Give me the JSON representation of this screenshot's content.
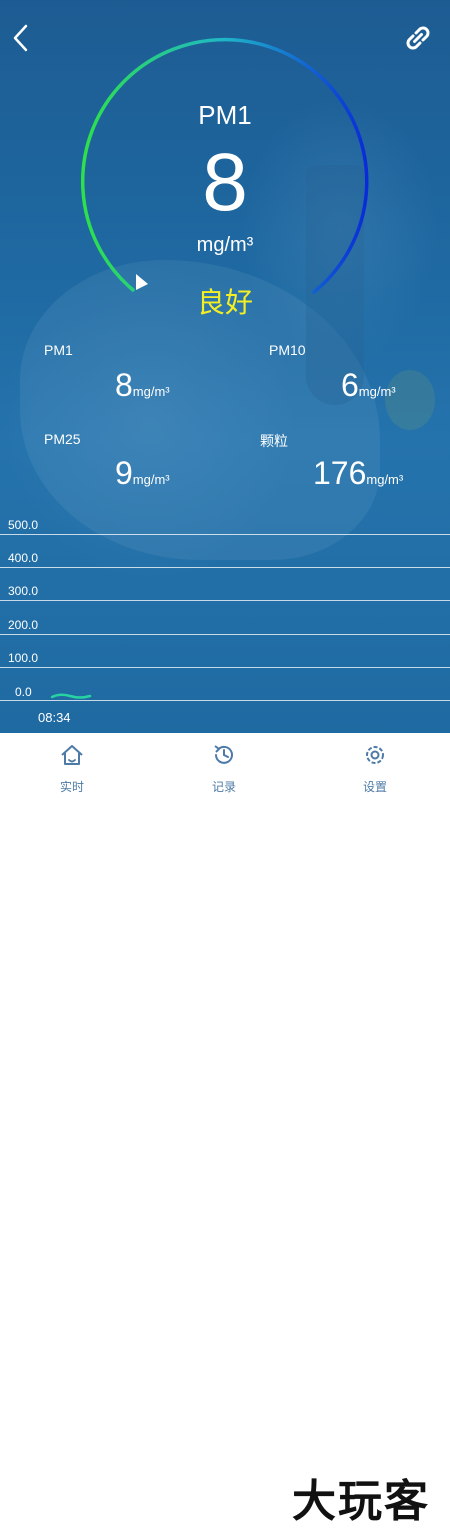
{
  "header": {
    "back_icon": "chevron-left-icon",
    "link_icon": "link-icon"
  },
  "gauge": {
    "title": "PM1",
    "value": "8",
    "unit": "mg/m³",
    "status": "良好",
    "colors": {
      "start": "#2ee04a",
      "end": "#0a2bd8"
    }
  },
  "metrics": [
    {
      "name": "PM1",
      "value": "8",
      "unit": "mg/m³"
    },
    {
      "name": "PM10",
      "value": "6",
      "unit": "mg/m³"
    },
    {
      "name": "PM25",
      "value": "9",
      "unit": "mg/m³"
    },
    {
      "name": "颗粒",
      "value": "176",
      "unit": "mg/m³"
    }
  ],
  "chart": {
    "y_ticks": [
      "500.0",
      "400.0",
      "300.0",
      "200.0",
      "100.0",
      "0.0"
    ],
    "time": "08:34",
    "line_color": "#27d3a0"
  },
  "tabbar": {
    "items": [
      {
        "label": "实时",
        "icon": "home-icon"
      },
      {
        "label": "记录",
        "icon": "history-icon"
      },
      {
        "label": "设置",
        "icon": "settings-icon"
      }
    ],
    "color": "#4d7aa6"
  },
  "watermark": "大玩客"
}
